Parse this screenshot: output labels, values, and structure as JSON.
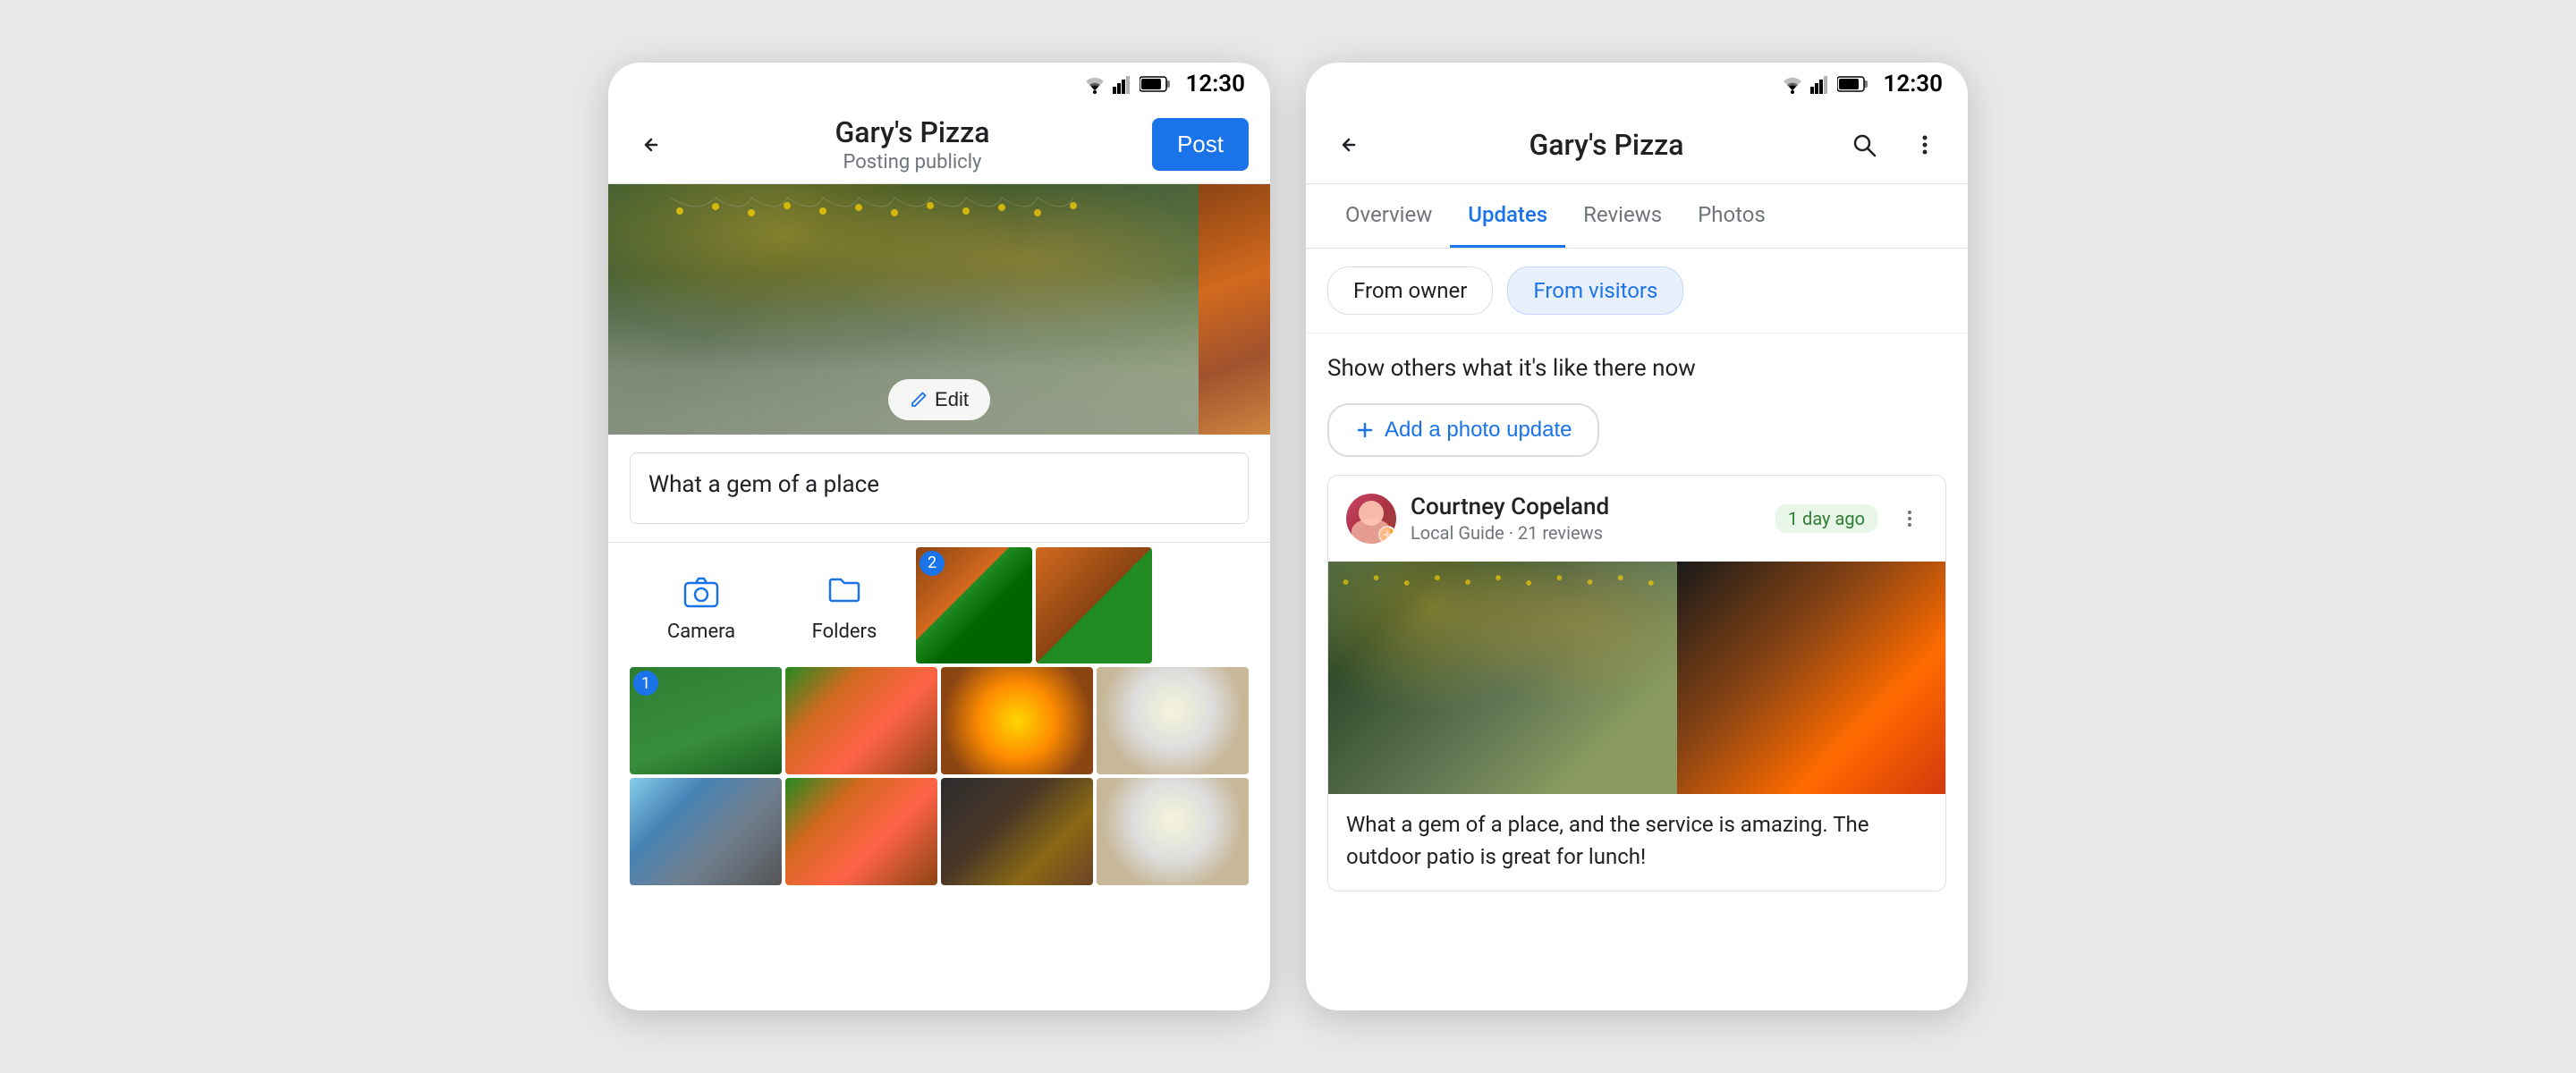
{
  "phone_left": {
    "status_bar": {
      "time": "12:30"
    },
    "top_nav": {
      "title": "Gary's Pizza",
      "subtitle": "Posting publicly",
      "post_button": "Post"
    },
    "photo_edit": {
      "edit_button": "Edit"
    },
    "caption": {
      "placeholder": "What a gem of a place",
      "value": "What a gem of a place"
    },
    "gallery": {
      "camera_label": "Camera",
      "folders_label": "Folders"
    }
  },
  "phone_right": {
    "status_bar": {
      "time": "12:30"
    },
    "top_nav": {
      "title": "Gary's Pizza"
    },
    "tabs": [
      {
        "label": "Overview",
        "active": false
      },
      {
        "label": "Updates",
        "active": true
      },
      {
        "label": "Reviews",
        "active": false
      },
      {
        "label": "Photos",
        "active": false
      }
    ],
    "owner_visitor": {
      "from_owner": "From owner",
      "from_visitors": "From visitors",
      "active": "from_visitors"
    },
    "show_others_text": "Show others what it's like there now",
    "add_photo_btn": "Add a photo update",
    "review": {
      "reviewer_name": "Courtney Copeland",
      "reviewer_sub": "Local Guide · 21 reviews",
      "time_badge": "1 day ago",
      "review_text": "What a gem of a place, and the service is amazing. The outdoor patio is great for lunch!"
    }
  }
}
